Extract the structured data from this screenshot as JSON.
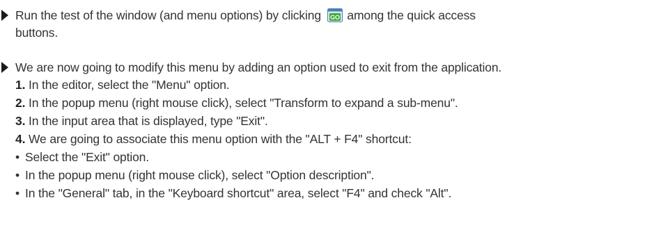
{
  "block1": {
    "line1_before": "Run the test of the window (and menu options) by clicking",
    "icon": "go-button-icon",
    "line1_after": "among the quick access",
    "line2": "buttons."
  },
  "block2": {
    "intro": "We are now going to modify this menu by adding an option used to exit from the application.",
    "steps": [
      {
        "num": "1.",
        "text": " In the editor, select the \"Menu\" option."
      },
      {
        "num": "2.",
        "text": " In the popup menu (right mouse click), select \"Transform to expand a sub-menu\"."
      },
      {
        "num": "3.",
        "text": " In the input area that is displayed, type \"Exit\"."
      },
      {
        "num": "4.",
        "text": " We are going to associate this menu option with the \"ALT + F4\" shortcut:"
      }
    ],
    "substeps": [
      "Select the \"Exit\" option.",
      "In the popup menu (right mouse click), select \"Option description\".",
      "In the \"General\" tab, in the \"Keyboard shortcut\" area, select \"F4\" and check \"Alt\"."
    ]
  }
}
